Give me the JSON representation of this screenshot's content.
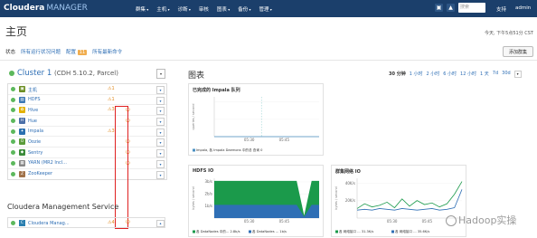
{
  "header": {
    "brand": "Cloudera",
    "product": "MANAGER",
    "nav": [
      "群集",
      "主机",
      "诊断",
      "审核",
      "图表",
      "备份",
      "管理"
    ],
    "search_placeholder": "搜索",
    "support": "支持",
    "user": "admin"
  },
  "page": {
    "title": "主页",
    "timestamp": "今天, 下午5点51分 CST",
    "tabs": [
      "状态",
      "所有运行状况问题",
      "配置",
      "所有最新命令"
    ],
    "config_badge": "11",
    "add_cluster": "添加群集"
  },
  "cluster": {
    "name": "Cluster 1",
    "version": "(CDH 5.10.2, Parcel)",
    "services": [
      {
        "name": "主机",
        "icon": "hosts-icon",
        "icon_color": "#6b8e23",
        "glyph": "▣",
        "warn": "1",
        "restart": false
      },
      {
        "name": "HDFS",
        "icon": "hdfs-icon",
        "icon_color": "#3c78b5",
        "glyph": "▤",
        "warn": "1",
        "restart": false
      },
      {
        "name": "Hive",
        "icon": "hive-icon",
        "icon_color": "#e3b100",
        "glyph": "✿",
        "warn": "3",
        "restart": true
      },
      {
        "name": "Hue",
        "icon": "hue-icon",
        "icon_color": "#4b6fa8",
        "glyph": "H",
        "warn": "",
        "restart": true
      },
      {
        "name": "Impala",
        "icon": "impala-icon",
        "icon_color": "#2a6fb0",
        "glyph": "✦",
        "warn": "3",
        "restart": false
      },
      {
        "name": "Oozie",
        "icon": "oozie-icon",
        "icon_color": "#5a9b3a",
        "glyph": "O",
        "warn": "",
        "restart": true
      },
      {
        "name": "Sentry",
        "icon": "sentry-icon",
        "icon_color": "#3a8a3a",
        "glyph": "◆",
        "warn": "",
        "restart": true
      },
      {
        "name": "YARN (MR2 Incl...",
        "icon": "yarn-icon",
        "icon_color": "#888888",
        "glyph": "▦",
        "warn": "",
        "restart": true
      },
      {
        "name": "ZooKeeper",
        "icon": "zookeeper-icon",
        "icon_color": "#a0724a",
        "glyph": "Z",
        "warn": "",
        "restart": false
      }
    ]
  },
  "cms": {
    "heading": "Cloudera Management Service",
    "service": "Cloudera Manag...",
    "warn": "4"
  },
  "charts": {
    "heading": "图表",
    "ranges": [
      "30 分钟",
      "1 小时",
      "2 小时",
      "6 小时",
      "12 小时",
      "1 天",
      "7d",
      "30d"
    ],
    "active_range": 0
  },
  "chart_data": [
    {
      "type": "line",
      "title": "已完成的 Impala 队列",
      "ylabel": "queries / second",
      "x_ticks": [
        "05:30",
        "05:45"
      ],
      "y_ticks": [
        "",
        ""
      ],
      "series": [
        {
          "name": "Impala, 各 Impala Daemons 中的总 查询 0",
          "values": [
            0,
            0,
            0,
            0,
            0,
            0,
            0,
            0,
            0,
            0
          ]
        }
      ]
    },
    {
      "type": "area",
      "title": "HDFS IO",
      "ylabel": "bytes / second",
      "x_ticks": [
        "05:30",
        "05:45"
      ],
      "y_ticks": [
        "1b/s",
        "2b/s",
        "3b/s"
      ],
      "ylim": [
        0,
        3
      ],
      "series": [
        {
          "name": "各 DataNodes 中的...",
          "value_label": "2.8b/s",
          "color": "#1b9a4b",
          "values": [
            2.8,
            2.8,
            2.8,
            2.8,
            2.8,
            2.8,
            2.8,
            2.8,
            2.8,
            2.8,
            2.8,
            2.8,
            0.2,
            2.8,
            2.8
          ]
        },
        {
          "name": "各 DataNodes ...",
          "value_label": "1b/s",
          "color": "#2f6fb5",
          "values": [
            1,
            1,
            1,
            1,
            1,
            1,
            1,
            1,
            1,
            1,
            1,
            1,
            0.1,
            1,
            1
          ]
        }
      ]
    },
    {
      "type": "line",
      "title": "群集网络 IO",
      "ylabel": "bytes / second",
      "x_ticks": [
        "05:30",
        "05:45"
      ],
      "y_ticks": [
        "20K/s",
        "40K/s"
      ],
      "ylim": [
        0,
        50
      ],
      "series": [
        {
          "name": "各 网络接口 ...",
          "value_label": "31.3K/s",
          "color": "#1b9a4b",
          "values": [
            12,
            18,
            14,
            16,
            20,
            13,
            24,
            15,
            22,
            17,
            19,
            14,
            18,
            30,
            46
          ]
        },
        {
          "name": "各 网络接口 ...",
          "value_label": "35.6K/s",
          "color": "#2f6fb5",
          "values": [
            10,
            11,
            10,
            12,
            11,
            10,
            12,
            11,
            10,
            11,
            12,
            10,
            11,
            13,
            36
          ]
        }
      ]
    }
  ],
  "watermark": "Hadoop实操"
}
